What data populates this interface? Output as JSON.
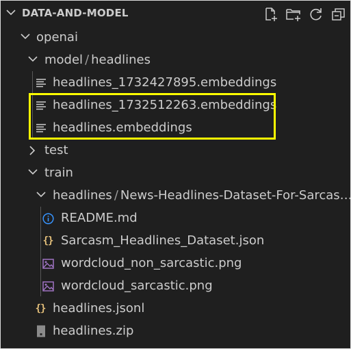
{
  "header": {
    "title": "DATA-AND-MODEL",
    "actions": [
      {
        "name": "new-file-icon"
      },
      {
        "name": "new-folder-icon"
      },
      {
        "name": "refresh-icon"
      },
      {
        "name": "collapse-all-icon"
      }
    ]
  },
  "tree": {
    "openai": {
      "label": "openai"
    },
    "model_folder": {
      "label_part1": "model",
      "separator": "/",
      "label_part2": "headlines"
    },
    "file_1": {
      "label": "headlines_1732427895.embeddings"
    },
    "file_2": {
      "label": "headlines_1732512263.embeddings"
    },
    "file_3": {
      "label": "headlines.embeddings"
    },
    "test_folder": {
      "label": "test"
    },
    "train_folder": {
      "label": "train"
    },
    "train_headlines": {
      "label_part1": "headlines",
      "separator": "/",
      "label_part2": "News-Headlines-Dataset-For-Sarcasm-Detection"
    },
    "readme": {
      "label": "README.md"
    },
    "sarcasm_json": {
      "label": "Sarcasm_Headlines_Dataset.json"
    },
    "wordcloud_non": {
      "label": "wordcloud_non_sarcastic.png"
    },
    "wordcloud": {
      "label": "wordcloud_sarcastic.png"
    },
    "jsonl": {
      "label": "headlines.jsonl"
    },
    "zip": {
      "label": "headlines.zip"
    }
  },
  "colors": {
    "background": "#1f1f1f",
    "text": "#cccccc",
    "highlight_border": "#ffff00",
    "info_icon": "#3794ff",
    "json_icon": "#e5c07b",
    "image_icon": "#a074c4"
  }
}
